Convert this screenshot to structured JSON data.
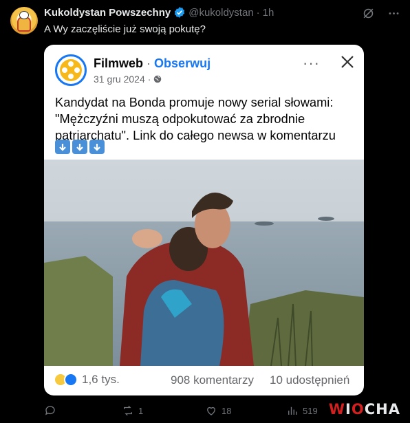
{
  "tweet": {
    "author_name": "Kukoldystan Powszechny",
    "handle": "@kukoldystan",
    "separator": "·",
    "time": "1h",
    "text": "A Wy zaczęliście już swoją pokutę?"
  },
  "embedded_post": {
    "page_name": "Filmweb",
    "separator": "·",
    "follow_label": "Obserwuj",
    "date": "31 gru 2024",
    "more_label": "···",
    "text": "Kandydat na Bonda promuje nowy serial słowami: \"Mężczyźni muszą odpokutować za zbrodnie patriarchatu\". Link do całego newsa w komentarzu",
    "arrow_emoji_count": 3,
    "reactions_count": "1,6 tys.",
    "comments": "908 komentarzy",
    "shares": "10 udostępnień"
  },
  "actions": {
    "reply_count": "",
    "retweet_count": "1",
    "like_count": "18",
    "views_count": "519"
  },
  "watermark": {
    "part1": "W",
    "part2": "I",
    "part3": "O",
    "part4": "C",
    "part5": "H",
    "part6": "A"
  },
  "colors": {
    "background": "#000000",
    "text_primary": "#e7e9ea",
    "text_secondary": "#71767b",
    "verified_blue": "#1d9bf0",
    "facebook_blue": "#1877f2"
  },
  "icons": {
    "verified": "verified-badge-icon",
    "grok": "grok-icon",
    "more": "more-icon",
    "close": "close-icon",
    "globe": "globe-icon",
    "reply": "reply-icon",
    "retweet": "retweet-icon",
    "like": "heart-icon",
    "views": "views-icon"
  }
}
